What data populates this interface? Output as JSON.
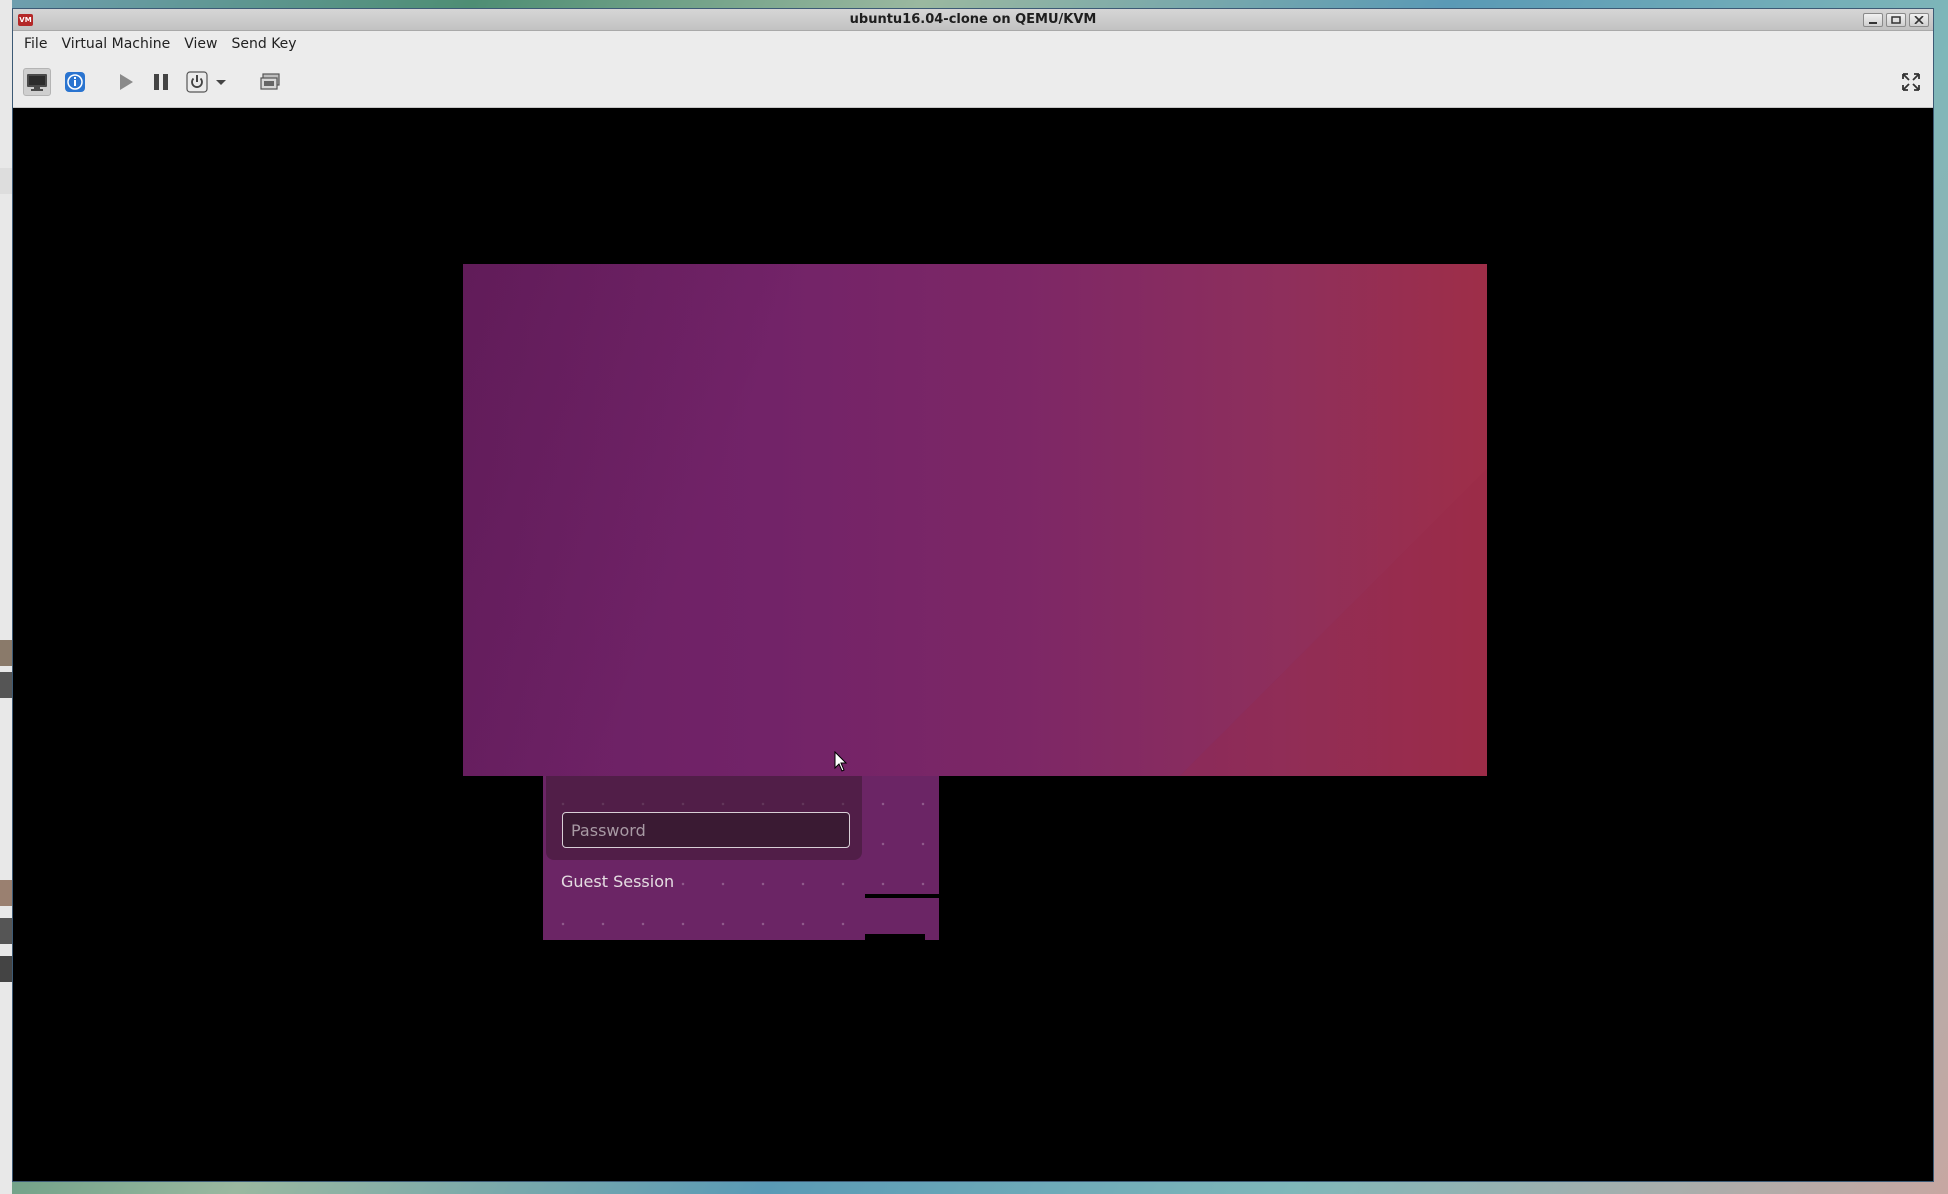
{
  "window": {
    "title": "ubuntu16.04-clone on QEMU/KVM",
    "app_icon_text": "VM"
  },
  "menubar": {
    "items": [
      {
        "label": "File"
      },
      {
        "label": "Virtual Machine"
      },
      {
        "label": "View"
      },
      {
        "label": "Send Key"
      }
    ]
  },
  "toolbar": {
    "buttons": [
      {
        "icon": "monitor-console-icon",
        "active": true
      },
      {
        "icon": "info-icon",
        "active": false
      },
      {
        "icon": "play-icon",
        "active": false
      },
      {
        "icon": "pause-icon",
        "active": false
      },
      {
        "icon": "power-icon",
        "active": false
      },
      {
        "icon": "chevron-down-icon",
        "active": false
      },
      {
        "icon": "snapshot-icon",
        "active": false
      },
      {
        "icon": "fullscreen-icon",
        "active": false
      }
    ]
  },
  "guest": {
    "login": {
      "password_placeholder": "Password",
      "password_value": "",
      "guest_session_label": "Guest Session"
    },
    "colors": {
      "aubergine": "#722368",
      "wallpaper_right": "#9e2e48"
    }
  }
}
